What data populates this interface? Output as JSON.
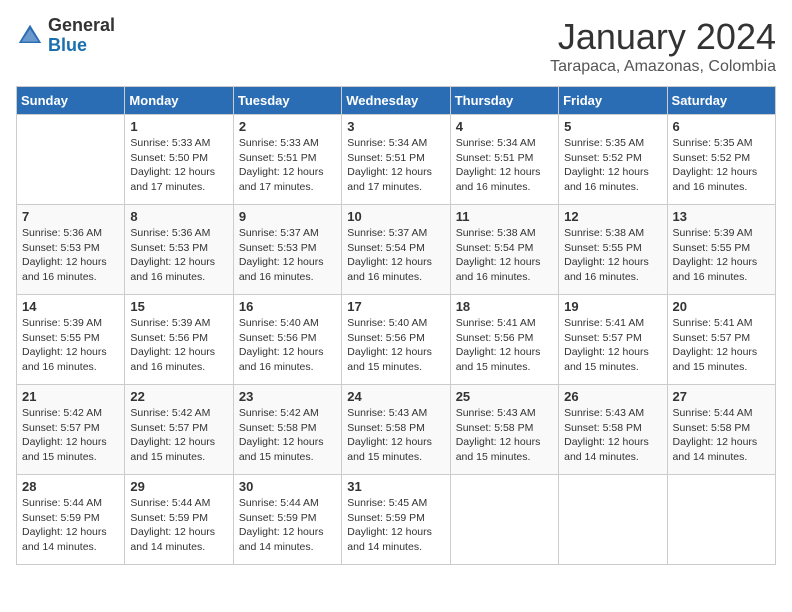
{
  "header": {
    "logo_general": "General",
    "logo_blue": "Blue",
    "month": "January 2024",
    "location": "Tarapaca, Amazonas, Colombia"
  },
  "columns": [
    "Sunday",
    "Monday",
    "Tuesday",
    "Wednesday",
    "Thursday",
    "Friday",
    "Saturday"
  ],
  "weeks": [
    [
      {
        "day": "",
        "sunrise": "",
        "sunset": "",
        "daylight": ""
      },
      {
        "day": "1",
        "sunrise": "Sunrise: 5:33 AM",
        "sunset": "Sunset: 5:50 PM",
        "daylight": "Daylight: 12 hours and 17 minutes."
      },
      {
        "day": "2",
        "sunrise": "Sunrise: 5:33 AM",
        "sunset": "Sunset: 5:51 PM",
        "daylight": "Daylight: 12 hours and 17 minutes."
      },
      {
        "day": "3",
        "sunrise": "Sunrise: 5:34 AM",
        "sunset": "Sunset: 5:51 PM",
        "daylight": "Daylight: 12 hours and 17 minutes."
      },
      {
        "day": "4",
        "sunrise": "Sunrise: 5:34 AM",
        "sunset": "Sunset: 5:51 PM",
        "daylight": "Daylight: 12 hours and 16 minutes."
      },
      {
        "day": "5",
        "sunrise": "Sunrise: 5:35 AM",
        "sunset": "Sunset: 5:52 PM",
        "daylight": "Daylight: 12 hours and 16 minutes."
      },
      {
        "day": "6",
        "sunrise": "Sunrise: 5:35 AM",
        "sunset": "Sunset: 5:52 PM",
        "daylight": "Daylight: 12 hours and 16 minutes."
      }
    ],
    [
      {
        "day": "7",
        "sunrise": "Sunrise: 5:36 AM",
        "sunset": "Sunset: 5:53 PM",
        "daylight": "Daylight: 12 hours and 16 minutes."
      },
      {
        "day": "8",
        "sunrise": "Sunrise: 5:36 AM",
        "sunset": "Sunset: 5:53 PM",
        "daylight": "Daylight: 12 hours and 16 minutes."
      },
      {
        "day": "9",
        "sunrise": "Sunrise: 5:37 AM",
        "sunset": "Sunset: 5:53 PM",
        "daylight": "Daylight: 12 hours and 16 minutes."
      },
      {
        "day": "10",
        "sunrise": "Sunrise: 5:37 AM",
        "sunset": "Sunset: 5:54 PM",
        "daylight": "Daylight: 12 hours and 16 minutes."
      },
      {
        "day": "11",
        "sunrise": "Sunrise: 5:38 AM",
        "sunset": "Sunset: 5:54 PM",
        "daylight": "Daylight: 12 hours and 16 minutes."
      },
      {
        "day": "12",
        "sunrise": "Sunrise: 5:38 AM",
        "sunset": "Sunset: 5:55 PM",
        "daylight": "Daylight: 12 hours and 16 minutes."
      },
      {
        "day": "13",
        "sunrise": "Sunrise: 5:39 AM",
        "sunset": "Sunset: 5:55 PM",
        "daylight": "Daylight: 12 hours and 16 minutes."
      }
    ],
    [
      {
        "day": "14",
        "sunrise": "Sunrise: 5:39 AM",
        "sunset": "Sunset: 5:55 PM",
        "daylight": "Daylight: 12 hours and 16 minutes."
      },
      {
        "day": "15",
        "sunrise": "Sunrise: 5:39 AM",
        "sunset": "Sunset: 5:56 PM",
        "daylight": "Daylight: 12 hours and 16 minutes."
      },
      {
        "day": "16",
        "sunrise": "Sunrise: 5:40 AM",
        "sunset": "Sunset: 5:56 PM",
        "daylight": "Daylight: 12 hours and 16 minutes."
      },
      {
        "day": "17",
        "sunrise": "Sunrise: 5:40 AM",
        "sunset": "Sunset: 5:56 PM",
        "daylight": "Daylight: 12 hours and 15 minutes."
      },
      {
        "day": "18",
        "sunrise": "Sunrise: 5:41 AM",
        "sunset": "Sunset: 5:56 PM",
        "daylight": "Daylight: 12 hours and 15 minutes."
      },
      {
        "day": "19",
        "sunrise": "Sunrise: 5:41 AM",
        "sunset": "Sunset: 5:57 PM",
        "daylight": "Daylight: 12 hours and 15 minutes."
      },
      {
        "day": "20",
        "sunrise": "Sunrise: 5:41 AM",
        "sunset": "Sunset: 5:57 PM",
        "daylight": "Daylight: 12 hours and 15 minutes."
      }
    ],
    [
      {
        "day": "21",
        "sunrise": "Sunrise: 5:42 AM",
        "sunset": "Sunset: 5:57 PM",
        "daylight": "Daylight: 12 hours and 15 minutes."
      },
      {
        "day": "22",
        "sunrise": "Sunrise: 5:42 AM",
        "sunset": "Sunset: 5:57 PM",
        "daylight": "Daylight: 12 hours and 15 minutes."
      },
      {
        "day": "23",
        "sunrise": "Sunrise: 5:42 AM",
        "sunset": "Sunset: 5:58 PM",
        "daylight": "Daylight: 12 hours and 15 minutes."
      },
      {
        "day": "24",
        "sunrise": "Sunrise: 5:43 AM",
        "sunset": "Sunset: 5:58 PM",
        "daylight": "Daylight: 12 hours and 15 minutes."
      },
      {
        "day": "25",
        "sunrise": "Sunrise: 5:43 AM",
        "sunset": "Sunset: 5:58 PM",
        "daylight": "Daylight: 12 hours and 15 minutes."
      },
      {
        "day": "26",
        "sunrise": "Sunrise: 5:43 AM",
        "sunset": "Sunset: 5:58 PM",
        "daylight": "Daylight: 12 hours and 14 minutes."
      },
      {
        "day": "27",
        "sunrise": "Sunrise: 5:44 AM",
        "sunset": "Sunset: 5:58 PM",
        "daylight": "Daylight: 12 hours and 14 minutes."
      }
    ],
    [
      {
        "day": "28",
        "sunrise": "Sunrise: 5:44 AM",
        "sunset": "Sunset: 5:59 PM",
        "daylight": "Daylight: 12 hours and 14 minutes."
      },
      {
        "day": "29",
        "sunrise": "Sunrise: 5:44 AM",
        "sunset": "Sunset: 5:59 PM",
        "daylight": "Daylight: 12 hours and 14 minutes."
      },
      {
        "day": "30",
        "sunrise": "Sunrise: 5:44 AM",
        "sunset": "Sunset: 5:59 PM",
        "daylight": "Daylight: 12 hours and 14 minutes."
      },
      {
        "day": "31",
        "sunrise": "Sunrise: 5:45 AM",
        "sunset": "Sunset: 5:59 PM",
        "daylight": "Daylight: 12 hours and 14 minutes."
      },
      {
        "day": "",
        "sunrise": "",
        "sunset": "",
        "daylight": ""
      },
      {
        "day": "",
        "sunrise": "",
        "sunset": "",
        "daylight": ""
      },
      {
        "day": "",
        "sunrise": "",
        "sunset": "",
        "daylight": ""
      }
    ]
  ]
}
